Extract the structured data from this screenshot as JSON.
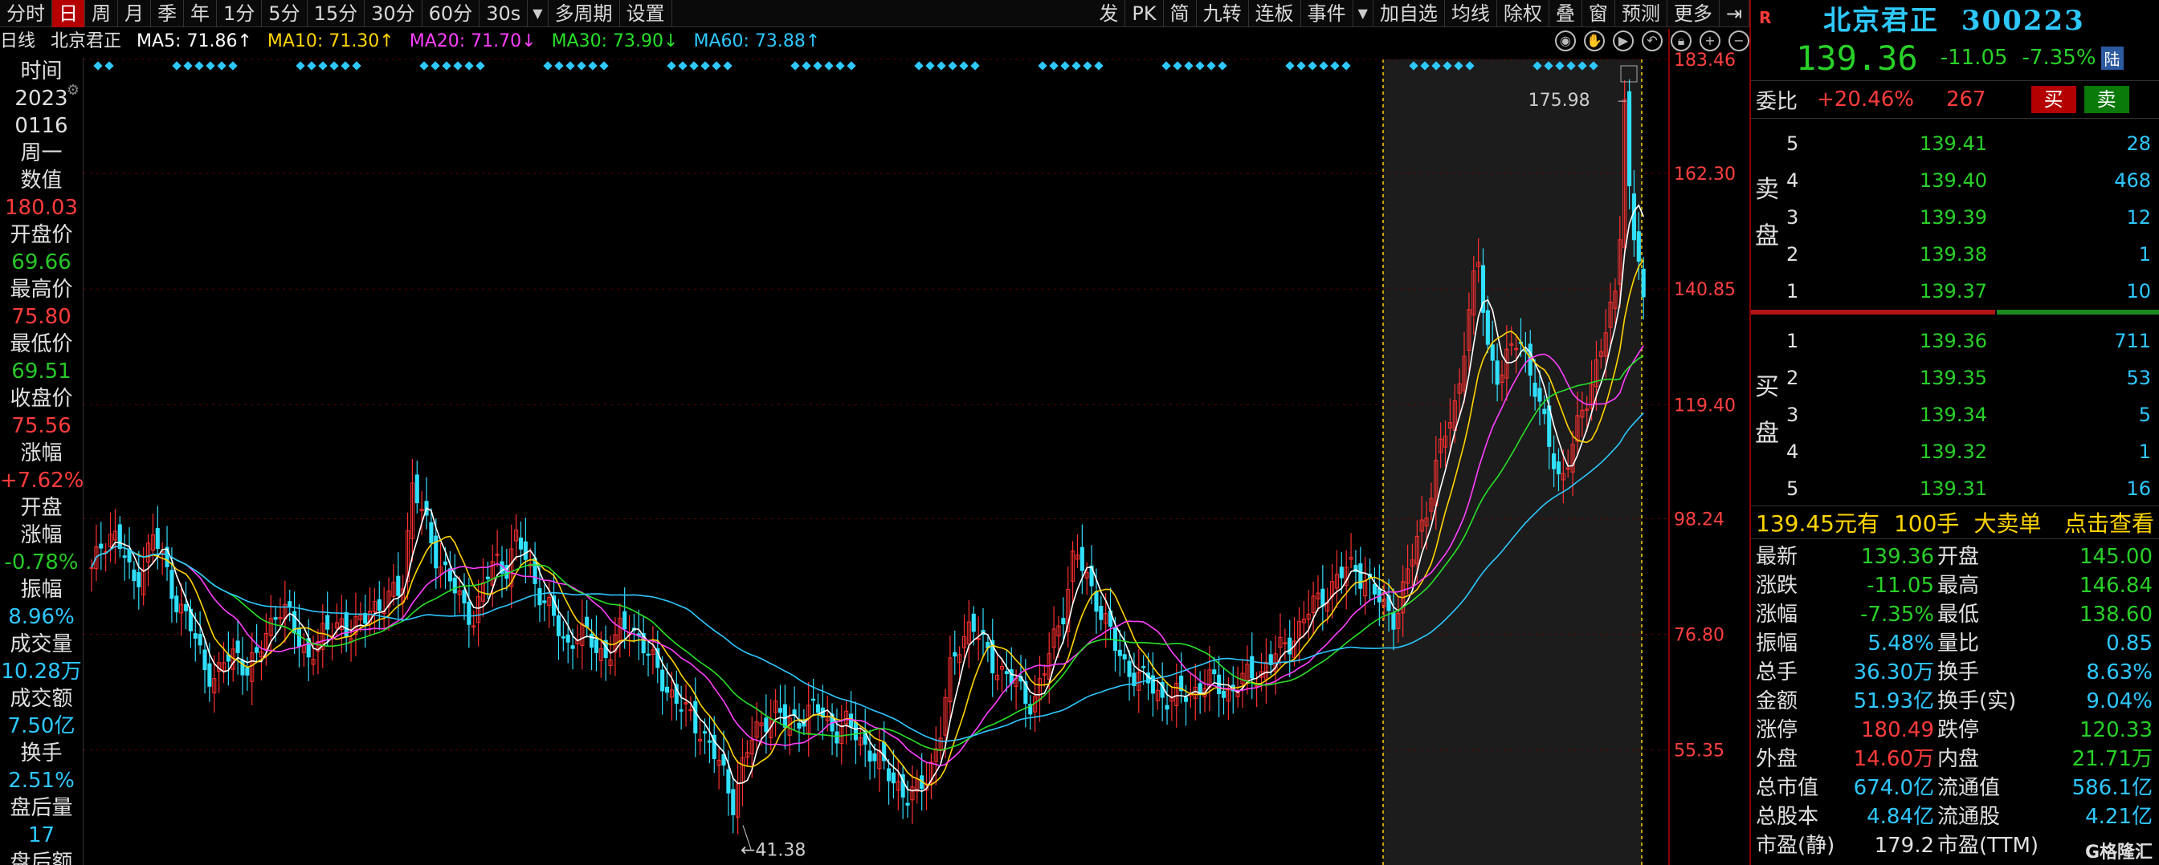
{
  "toolbar": {
    "left": [
      "分时",
      "日",
      "周",
      "月",
      "季",
      "年",
      "1分",
      "5分",
      "15分",
      "30分",
      "60分",
      "30s",
      "多周期",
      "设置"
    ],
    "active": "日",
    "right": [
      "发",
      "PK",
      "简",
      "九转",
      "连板",
      "事件",
      "加自选",
      "均线",
      "除权",
      "叠",
      "窗",
      "预测",
      "更多"
    ]
  },
  "maline": {
    "period": "日线",
    "name": "北京君正",
    "ma5": "MA5: 71.86↑",
    "ma10": "MA10: 71.30↑",
    "ma20": "MA20: 71.70↓",
    "ma30": "MA30: 73.90↓",
    "ma60": "MA60: 73.88↑"
  },
  "infocol": [
    {
      "t": "时间",
      "c": "label"
    },
    {
      "t": "2023",
      "c": "label"
    },
    {
      "t": "0116",
      "c": "label"
    },
    {
      "t": "周一",
      "c": "label"
    },
    {
      "t": "数值",
      "c": "label"
    },
    {
      "t": "180.03",
      "c": "red"
    },
    {
      "t": "开盘价",
      "c": "label"
    },
    {
      "t": "69.66",
      "c": "green"
    },
    {
      "t": "最高价",
      "c": "label"
    },
    {
      "t": "75.80",
      "c": "red"
    },
    {
      "t": "最低价",
      "c": "label"
    },
    {
      "t": "69.51",
      "c": "green"
    },
    {
      "t": "收盘价",
      "c": "label"
    },
    {
      "t": "75.56",
      "c": "red"
    },
    {
      "t": "涨幅",
      "c": "label"
    },
    {
      "t": "+7.62%",
      "c": "red"
    },
    {
      "t": "开盘",
      "c": "label"
    },
    {
      "t": "涨幅",
      "c": "label"
    },
    {
      "t": "-0.78%",
      "c": "green"
    },
    {
      "t": "振幅",
      "c": "label"
    },
    {
      "t": "8.96%",
      "c": "cyan"
    },
    {
      "t": "成交量",
      "c": "label"
    },
    {
      "t": "10.28万",
      "c": "cyan"
    },
    {
      "t": "成交额",
      "c": "label"
    },
    {
      "t": "7.50亿",
      "c": "cyan"
    },
    {
      "t": "换手",
      "c": "label"
    },
    {
      "t": "2.51%",
      "c": "cyan"
    },
    {
      "t": "盘后量",
      "c": "label"
    },
    {
      "t": "17",
      "c": "cyan"
    },
    {
      "t": "盘后额",
      "c": "label"
    }
  ],
  "chart_data": {
    "type": "candlestick",
    "y_ticks": [
      "183.46",
      "162.30",
      "140.85",
      "119.40",
      "98.24",
      "76.80",
      "55.35"
    ],
    "high_label": "175.98",
    "low_label": "41.38",
    "close_series": [
      88,
      94,
      96,
      92,
      86,
      90,
      95,
      90,
      84,
      80,
      76,
      71,
      68,
      72,
      74,
      70,
      72,
      78,
      82,
      80,
      76,
      73,
      75,
      78,
      80,
      76,
      79,
      83,
      81,
      84,
      86,
      104,
      99,
      93,
      89,
      85,
      82,
      80,
      86,
      91,
      89,
      94,
      91,
      86,
      82,
      78,
      75,
      77,
      76,
      74,
      73,
      77,
      79,
      76,
      72,
      69,
      66,
      63,
      61,
      59,
      55,
      51,
      46,
      53,
      58,
      61,
      63,
      60,
      61,
      62,
      63,
      61,
      59,
      60,
      58,
      56,
      53,
      51,
      49,
      46,
      48,
      52,
      58,
      70,
      76,
      79,
      75,
      72,
      70,
      68,
      66,
      64,
      69,
      76,
      82,
      92,
      88,
      84,
      79,
      74,
      71,
      69,
      68,
      66,
      65,
      65,
      66,
      67,
      68,
      67,
      66,
      68,
      69,
      70,
      72,
      74,
      76,
      79,
      82,
      84,
      86,
      88,
      90,
      87,
      84,
      82,
      80,
      86,
      94,
      100,
      108,
      115,
      121,
      135,
      146,
      130,
      124,
      128,
      133,
      126,
      118,
      112,
      105,
      110,
      118,
      124,
      130,
      138,
      144,
      142,
      140
    ],
    "ma_colors": [
      "#ffffff",
      "#ffd400",
      "#ff40ff",
      "#28e028",
      "#2ec8ff"
    ]
  },
  "panel": {
    "r_badge": "R",
    "stock_name": "北京君正",
    "code": "300223",
    "last": "139.36",
    "chg": "-11.05",
    "chgpct": "-7.35%",
    "lu": "陆",
    "weibi_label": "委比",
    "weibi_val": "+20.46%",
    "weibi_vol": "267",
    "buy": "买",
    "sell": "卖",
    "sell_side": "卖盘",
    "buy_side": "买盘",
    "asks": [
      {
        "lvl": "5",
        "p": "139.41",
        "v": "28"
      },
      {
        "lvl": "4",
        "p": "139.40",
        "v": "468"
      },
      {
        "lvl": "3",
        "p": "139.39",
        "v": "12"
      },
      {
        "lvl": "2",
        "p": "139.38",
        "v": "1"
      },
      {
        "lvl": "1",
        "p": "139.37",
        "v": "10"
      }
    ],
    "bids": [
      {
        "lvl": "1",
        "p": "139.36",
        "v": "711"
      },
      {
        "lvl": "2",
        "p": "139.35",
        "v": "53"
      },
      {
        "lvl": "3",
        "p": "139.34",
        "v": "5"
      },
      {
        "lvl": "4",
        "p": "139.32",
        "v": "1"
      },
      {
        "lvl": "5",
        "p": "139.31",
        "v": "16"
      }
    ],
    "bigorder": {
      "price": "139.45元有",
      "vol": "100手",
      "label": "大卖单",
      "action": "点击查看"
    },
    "quotes": [
      {
        "l1": "最新",
        "v1": "139.36",
        "c1": "cg",
        "l2": "开盘",
        "v2": "145.00",
        "c2": "cg"
      },
      {
        "l1": "涨跌",
        "v1": "-11.05",
        "c1": "cg",
        "l2": "最高",
        "v2": "146.84",
        "c2": "cg"
      },
      {
        "l1": "涨幅",
        "v1": "-7.35%",
        "c1": "cg",
        "l2": "最低",
        "v2": "138.60",
        "c2": "cg"
      },
      {
        "l1": "振幅",
        "v1": "5.48%",
        "c1": "cc",
        "l2": "量比",
        "v2": "0.85",
        "c2": "cc"
      },
      {
        "l1": "总手",
        "v1": "36.30万",
        "c1": "cc",
        "l2": "换手",
        "v2": "8.63%",
        "c2": "cc"
      },
      {
        "l1": "金额",
        "v1": "51.93亿",
        "c1": "cc",
        "l2": "换手(实)",
        "v2": "9.04%",
        "c2": "cc"
      },
      {
        "l1": "涨停",
        "v1": "180.49",
        "c1": "cr",
        "l2": "跌停",
        "v2": "120.33",
        "c2": "cg"
      },
      {
        "l1": "外盘",
        "v1": "14.60万",
        "c1": "cr",
        "l2": "内盘",
        "v2": "21.71万",
        "c2": "cg"
      },
      {
        "l1": "总市值",
        "v1": "674.0亿",
        "c1": "cc",
        "l2": "流通值",
        "v2": "586.1亿",
        "c2": "cc"
      },
      {
        "l1": "总股本",
        "v1": "4.84亿",
        "c1": "cc",
        "l2": "流通股",
        "v2": "4.21亿",
        "c2": "cc"
      },
      {
        "l1": "市盈(静)",
        "v1": "179.2",
        "c1": "cw",
        "l2": "市盈(TTM)",
        "v2": "",
        "c2": "cw"
      }
    ],
    "watermark": "G格隆汇"
  }
}
